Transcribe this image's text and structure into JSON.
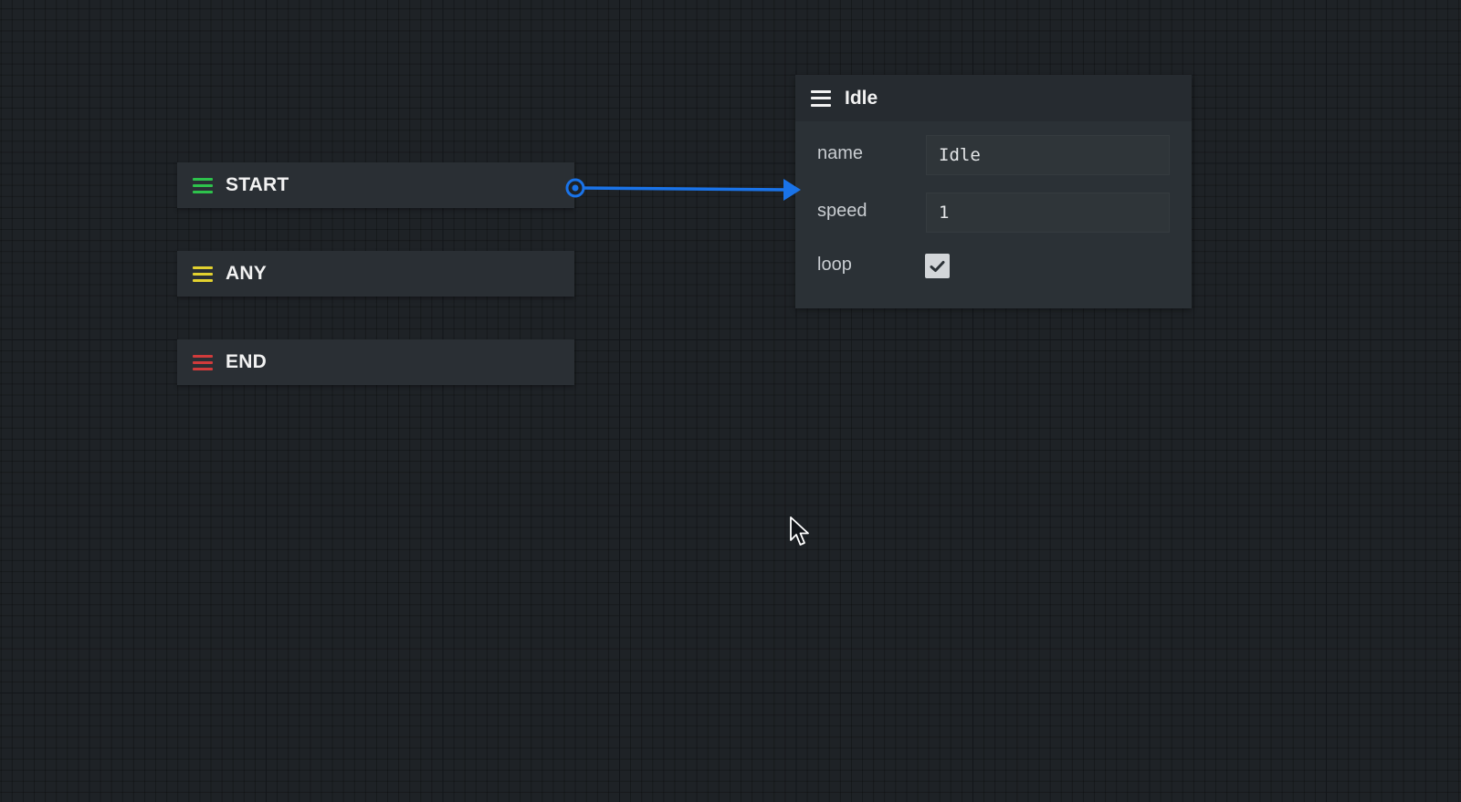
{
  "canvas": {
    "background": "#1e2226"
  },
  "entry_nodes": [
    {
      "id": "start",
      "label": "START",
      "handle_color": "#2ec24c",
      "handle_icon": "hamburger-icon"
    },
    {
      "id": "any",
      "label": "ANY",
      "handle_color": "#e2d12f",
      "handle_icon": "hamburger-icon"
    },
    {
      "id": "end",
      "label": "END",
      "handle_color": "#d13b3b",
      "handle_icon": "hamburger-icon"
    }
  ],
  "state_node": {
    "title": "Idle",
    "handle_icon": "hamburger-icon",
    "properties": {
      "name": {
        "label": "name",
        "value": "Idle"
      },
      "speed": {
        "label": "speed",
        "value": "1"
      },
      "loop": {
        "label": "loop",
        "checked": true
      }
    }
  },
  "connection": {
    "from": "START",
    "to": "Idle",
    "color": "#1a73e8"
  },
  "cursor_icon": "mouse-pointer-icon"
}
